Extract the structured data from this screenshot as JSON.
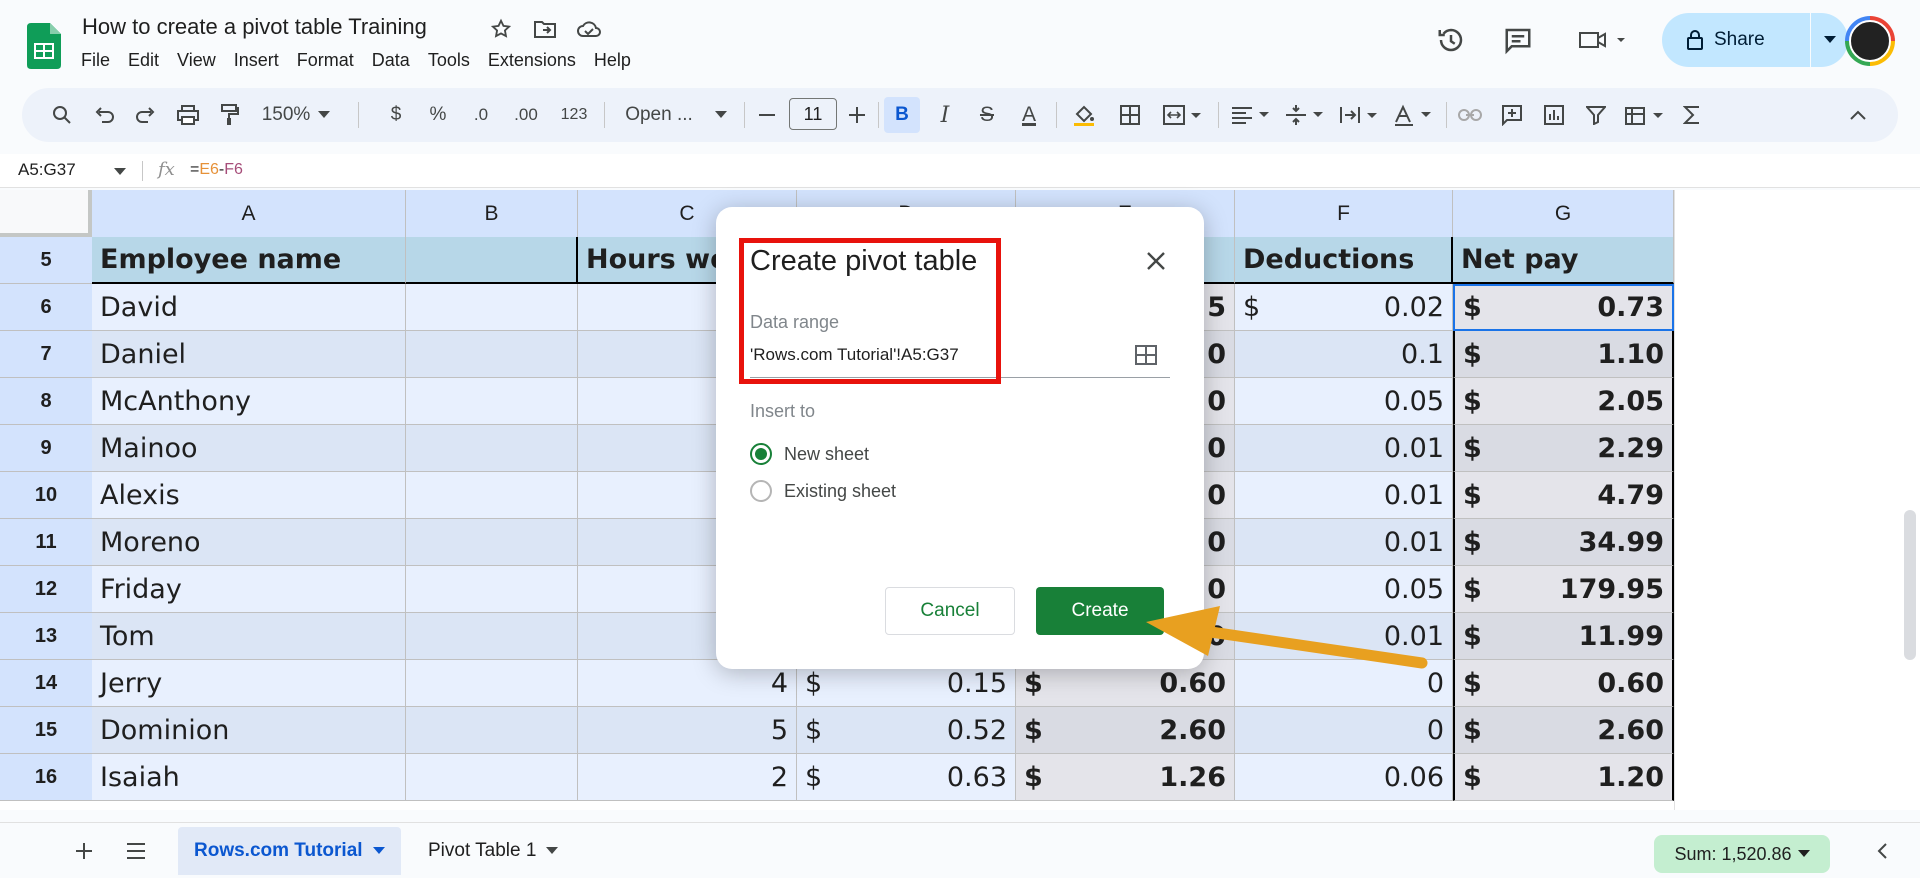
{
  "header": {
    "doc_title": "How to create a pivot table Training",
    "menus": [
      "File",
      "Edit",
      "View",
      "Insert",
      "Format",
      "Data",
      "Tools",
      "Extensions",
      "Help"
    ],
    "share_label": "Share"
  },
  "toolbar": {
    "zoom": "150%",
    "currency": "$",
    "percent": "%",
    "dec_decrease": ".0",
    "dec_increase": ".00",
    "number_format": "123",
    "font": "Open ...",
    "font_size": "11",
    "bold": "B",
    "italic": "I",
    "strike": "S",
    "text_color": "A"
  },
  "formula_bar": {
    "name_box": "A5:G37",
    "fx": "fx",
    "formula_eq": "=",
    "formula_ref1": "E6",
    "formula_op": "-",
    "formula_ref2": "F6"
  },
  "grid": {
    "columns": [
      "A",
      "B",
      "C",
      "D",
      "E",
      "F",
      "G"
    ],
    "rows": [
      {
        "num": "5",
        "A": "Employee name",
        "C": "Hours wo",
        "E": "",
        "F": "Deductions",
        "G": "Net pay"
      },
      {
        "num": "6",
        "A": "David",
        "E": "5",
        "F_cur": "$",
        "F": "0.02",
        "G_cur": "$",
        "G": "0.73"
      },
      {
        "num": "7",
        "A": "Daniel",
        "E": "0",
        "F": "0.1",
        "G_cur": "$",
        "G": "1.10"
      },
      {
        "num": "8",
        "A": "McAnthony",
        "E": "0",
        "F": "0.05",
        "G_cur": "$",
        "G": "2.05"
      },
      {
        "num": "9",
        "A": "Mainoo",
        "E": "0",
        "F": "0.01",
        "G_cur": "$",
        "G": "2.29"
      },
      {
        "num": "10",
        "A": "Alexis",
        "E": "0",
        "F": "0.01",
        "G_cur": "$",
        "G": "4.79"
      },
      {
        "num": "11",
        "A": "Moreno",
        "E": "0",
        "F": "0.01",
        "G_cur": "$",
        "G": "34.99"
      },
      {
        "num": "12",
        "A": "Friday",
        "E": "0",
        "F": "0.05",
        "G_cur": "$",
        "G": "179.95"
      },
      {
        "num": "13",
        "A": "Tom",
        "E": "0",
        "F": "0.01",
        "G_cur": "$",
        "G": "11.99"
      },
      {
        "num": "14",
        "A": "Jerry",
        "C": "4",
        "D_cur": "$",
        "D": "0.15",
        "E_cur": "$",
        "E": "0.60",
        "F": "0",
        "G_cur": "$",
        "G": "0.60"
      },
      {
        "num": "15",
        "A": "Dominion",
        "C": "5",
        "D_cur": "$",
        "D": "0.52",
        "E_cur": "$",
        "E": "2.60",
        "F": "0",
        "G_cur": "$",
        "G": "2.60"
      },
      {
        "num": "16",
        "A": "Isaiah",
        "C": "2",
        "D_cur": "$",
        "D": "0.63",
        "E_cur": "$",
        "E": "1.26",
        "F": "0.06",
        "G_cur": "$",
        "G": "1.20"
      }
    ]
  },
  "dialog": {
    "title": "Create pivot table",
    "data_range_label": "Data range",
    "data_range_value": "'Rows.com Tutorial'!A5:G37",
    "insert_to_label": "Insert to",
    "option_new": "New sheet",
    "option_existing": "Existing sheet",
    "cancel": "Cancel",
    "create": "Create"
  },
  "bottom": {
    "tabs": [
      "Rows.com Tutorial",
      "Pivot Table 1"
    ],
    "sum": "Sum: 1,520.86"
  },
  "colors": {
    "accent_green": "#188038",
    "highlight_red": "#e8120c",
    "arrow_orange": "#e8a020",
    "share_blue": "#c2e7ff"
  }
}
